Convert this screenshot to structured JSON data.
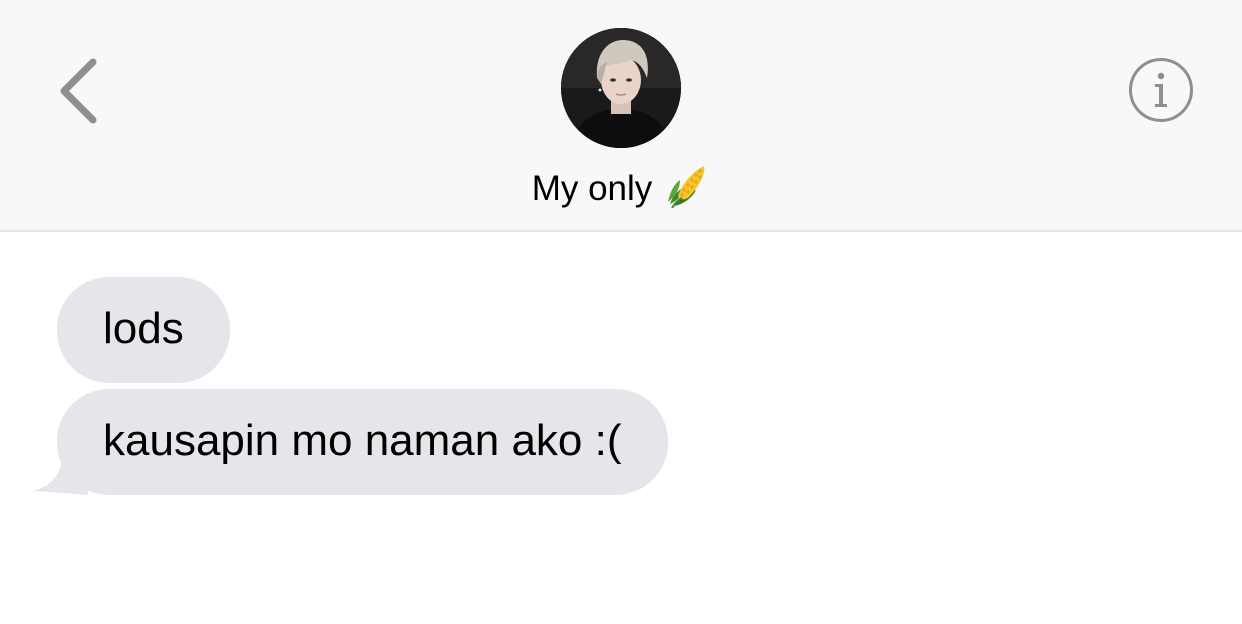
{
  "header": {
    "contact_name": "My only",
    "back_icon": "chevron-left-icon",
    "info_icon": "info-icon",
    "name_emoji": "corn-icon"
  },
  "messages": [
    {
      "sender": "contact",
      "text": "lods"
    },
    {
      "sender": "contact",
      "text": "kausapin mo naman ako :("
    }
  ],
  "colors": {
    "header_bg": "#f8f8f8",
    "incoming_bubble": "#e5e5ea",
    "icon_gray": "#8e8e93"
  }
}
